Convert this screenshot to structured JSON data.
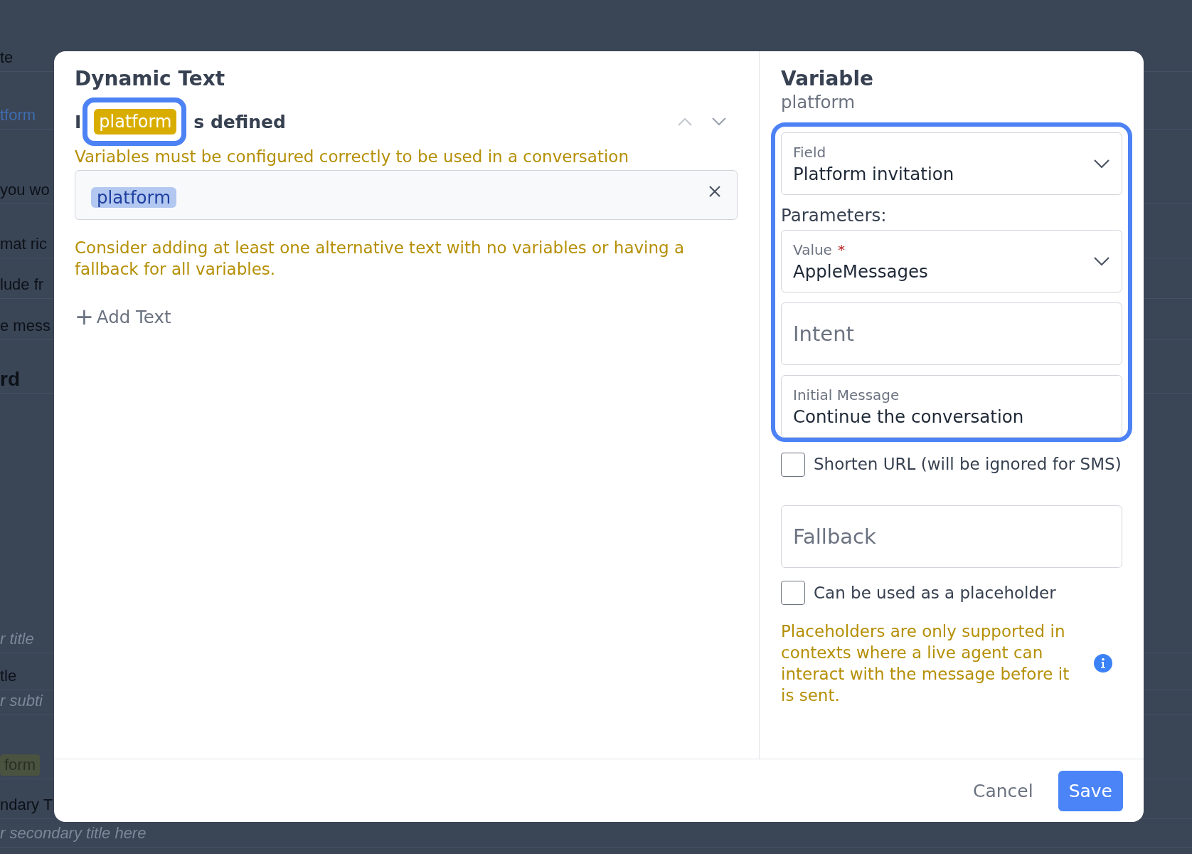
{
  "background": [
    {
      "kind": "text",
      "text": "te"
    },
    {
      "kind": "link",
      "text": "tform"
    },
    {
      "kind": "text",
      "text": "you wo"
    },
    {
      "kind": "text",
      "text": "mat ric"
    },
    {
      "kind": "text",
      "text": "lude fr"
    },
    {
      "kind": "text",
      "text": "e mess"
    },
    {
      "kind": "heading",
      "text": "rd"
    },
    {
      "kind": "italic",
      "text": "r title"
    },
    {
      "kind": "text",
      "text": "tle"
    },
    {
      "kind": "italic",
      "text": "r subti"
    },
    {
      "kind": "badge",
      "text": "form"
    },
    {
      "kind": "text",
      "text": "ndary T"
    },
    {
      "kind": "italic",
      "text": "r secondary title here"
    }
  ],
  "dialog": {
    "title": "Dynamic Text",
    "condition": {
      "prefix": "I",
      "chip": "platform",
      "suffix": "s defined",
      "highlighted": true
    },
    "warning": "Variables must be configured correctly to be used in a conversation",
    "text_input": {
      "chip": "platform"
    },
    "hint": "Consider adding at least one alternative text with no variables or having a fallback for all variables.",
    "add_text": {
      "icon": "+",
      "label": "Add Text"
    },
    "variable_panel": {
      "title": "Variable",
      "subtitle": "platform",
      "highlighted": true,
      "fields": [
        {
          "kind": "select",
          "label": "Field",
          "value": "Platform invitation"
        },
        {
          "kind": "heading",
          "label": "Parameters:"
        },
        {
          "kind": "select",
          "label": "Value",
          "value": "AppleMessages",
          "required_mark": "*"
        },
        {
          "kind": "input",
          "placeholder": "Intent"
        },
        {
          "kind": "input",
          "label": "Initial Message",
          "value": "Continue the conversation"
        }
      ],
      "shorten_url": {
        "label": "Shorten URL (will be ignored for SMS)",
        "checked": false
      },
      "fallback": {
        "placeholder": "Fallback"
      },
      "placeholder_option": {
        "label": "Can be used as a placeholder",
        "checked": false
      },
      "placeholder_note": "Placeholders are only supported in contexts where a live agent can interact with the message before it is sent."
    },
    "buttons": [
      {
        "kind": "secondary",
        "label": "Cancel"
      },
      {
        "kind": "primary",
        "label": "Save"
      }
    ]
  }
}
